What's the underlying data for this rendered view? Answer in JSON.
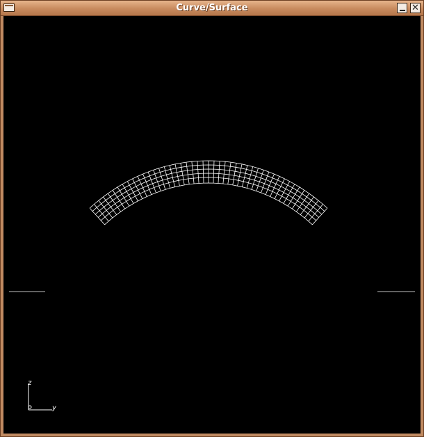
{
  "window": {
    "title": "Curve/Surface",
    "controls": {
      "minimize_icon": "minimize-icon",
      "close_icon": "close-icon",
      "menu_icon": "window-menu-icon"
    }
  },
  "viewport": {
    "background": "#000000",
    "mesh_color": "#ffffff",
    "axes": {
      "z_label": "z",
      "y_label": "y",
      "x_label": ""
    }
  }
}
